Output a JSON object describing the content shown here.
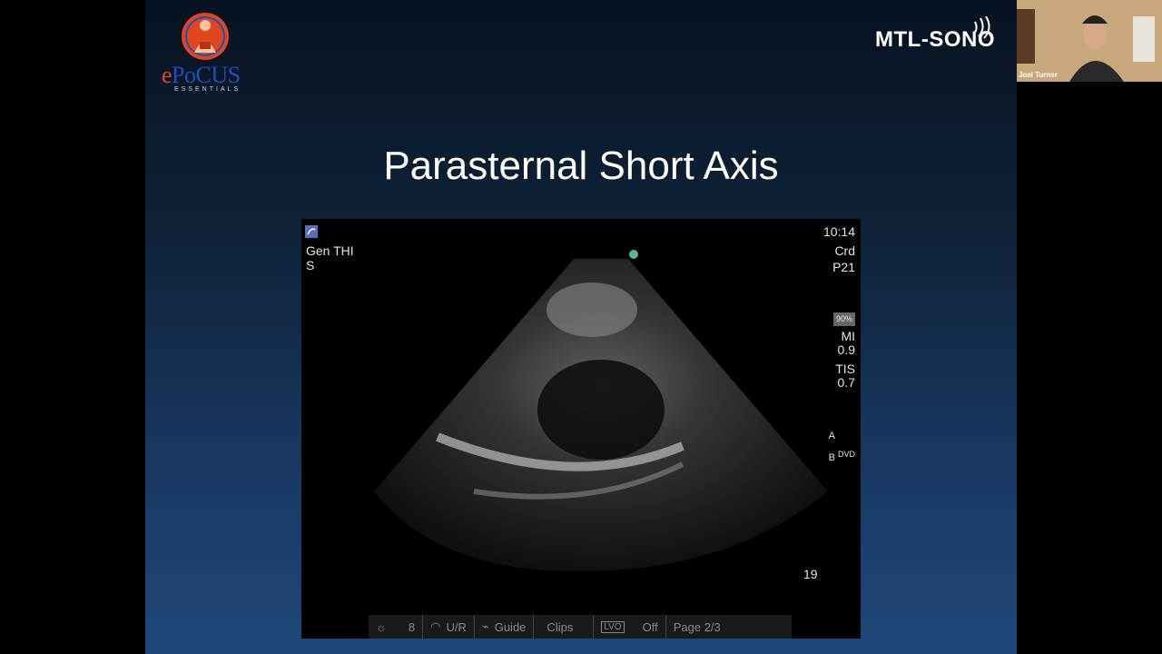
{
  "slide": {
    "title": "Parasternal Short Axis",
    "logo_left": {
      "prefix": "e",
      "main": "PoCUS",
      "subtitle": "ESSENTIALS"
    },
    "logo_right": {
      "text": "MTL-SONO"
    }
  },
  "ultrasound": {
    "top_left": {
      "line1": "Gen  THI",
      "line2": "S"
    },
    "top_right": {
      "time": "10:14",
      "preset": "Crd",
      "probe": "P21",
      "percent": "90%",
      "mi_label": "MI",
      "mi_value": "0.9",
      "tis_label": "TIS",
      "tis_value": "0.7",
      "a_label": "A",
      "b_label": "B",
      "dvd_label": "DVD"
    },
    "depth": "19",
    "bottom_bar": {
      "gain": "8",
      "ur": "U/R",
      "guide": "Guide",
      "clips": "Clips",
      "lvo": "LVO",
      "lvo_state": "Off",
      "page": "Page 2/3"
    }
  },
  "participant": {
    "name": "Joel Turner"
  },
  "colors": {
    "accent_orange": "#e0461f",
    "accent_blue": "#1f4fb8",
    "slide_bg": "#1a3a66"
  }
}
